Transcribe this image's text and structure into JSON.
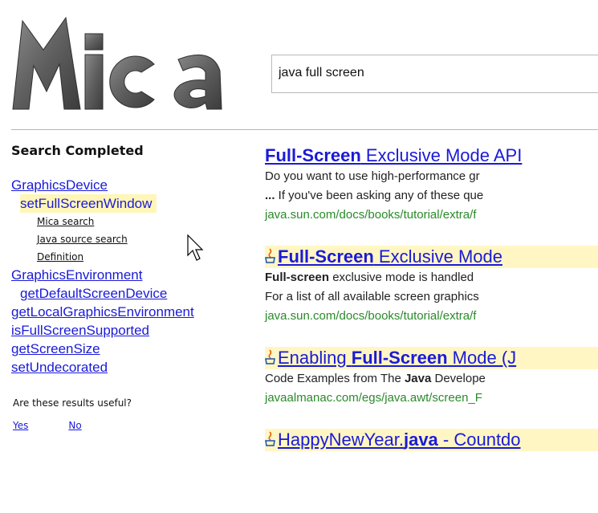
{
  "logo": {
    "text": "Mica"
  },
  "search": {
    "value": "java full screen"
  },
  "sidebar": {
    "status": "Search Completed",
    "tree": [
      {
        "label": "GraphicsDevice",
        "level": 1
      },
      {
        "label": "setFullScreenWindow",
        "level": 2,
        "highlight": true
      },
      {
        "label": "Mica search",
        "level": 3
      },
      {
        "label": "Java source search",
        "level": 3
      },
      {
        "label": "Definition",
        "level": 3
      },
      {
        "label": "GraphicsEnvironment",
        "level": 1
      },
      {
        "label": "getDefaultScreenDevice",
        "level": 2
      },
      {
        "label": "getLocalGraphicsEnvironment",
        "level": 1
      },
      {
        "label": "isFullScreenSupported",
        "level": 1
      },
      {
        "label": "getScreenSize",
        "level": 1
      },
      {
        "label": "setUndecorated",
        "level": 1
      }
    ],
    "useful_question": "Are these results useful?",
    "yes_label": "Yes",
    "no_label": "No"
  },
  "results": [
    {
      "title_bold": "Full-Screen",
      "title_rest": " Exclusive Mode API",
      "java_icon": false,
      "boxed": false,
      "snippet1": "Do you want to use high-performance gr",
      "snippet2": "... If you've been asking any of these que",
      "url": "java.sun.com/docs/books/tutorial/extra/f"
    },
    {
      "title_bold": "Full-Screen",
      "title_rest": " Exclusive Mode",
      "java_icon": true,
      "boxed": true,
      "snippet1": "Full-screen exclusive mode is handled",
      "snippet2": "For a list of all available screen graphics",
      "url": "java.sun.com/docs/books/tutorial/extra/f"
    },
    {
      "title_pre": "Enabling ",
      "title_bold": "Full-Screen",
      "title_rest": " Mode (J",
      "java_icon": true,
      "boxed": true,
      "snippet1": "Code Examples from The Java Develope",
      "url": "javaalmanac.com/egs/java.awt/screen_F"
    },
    {
      "title_pre": "HappyNewYear.",
      "title_bold": "java",
      "title_rest": " - Countdo",
      "java_icon": true,
      "boxed": true
    }
  ],
  "colors": {
    "link": "#1a1ad8",
    "url": "#2a8a2a",
    "highlight": "#fff6b8"
  }
}
